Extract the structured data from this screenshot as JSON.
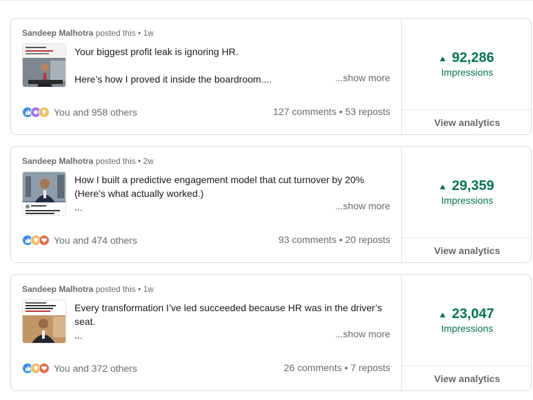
{
  "posts": [
    {
      "author": "Sandeep Malhotra",
      "posted_suffix": " posted this • 1w",
      "lines": [
        "Your biggest profit leak is ignoring HR.",
        "",
        "Here’s how I proved it inside the boardroom...."
      ],
      "show_more": "...show more",
      "reactions": "You and 958 others",
      "stats": "127 comments • 53 reposts",
      "impressions": "92,286",
      "impressions_label": "Impressions",
      "view_analytics": "View analytics"
    },
    {
      "author": "Sandeep Malhotra",
      "posted_suffix": " posted this • 2w",
      "lines": [
        "How I built a predictive engagement model that cut turnover by 20%",
        "(Here’s what actually worked.)",
        "..."
      ],
      "show_more": "...show more",
      "reactions": "You and 474 others",
      "stats": "93 comments • 20 reposts",
      "impressions": "29,359",
      "impressions_label": "Impressions",
      "view_analytics": "View analytics"
    },
    {
      "author": "Sandeep Malhotra",
      "posted_suffix": " posted this • 1w",
      "lines": [
        "Every transformation I’ve led succeeded because HR was in the driver’s",
        "seat.",
        "..."
      ],
      "show_more": "...show more",
      "reactions": "You and 372 others",
      "stats": "26 comments • 7 reposts",
      "impressions": "23,047",
      "impressions_label": "Impressions",
      "view_analytics": "View analytics"
    }
  ],
  "icons": {
    "thumbnail": "post-thumbnail-image",
    "like": "like-reaction-icon",
    "insightful": "insightful-reaction-icon",
    "support": "support-reaction-icon",
    "love": "love-reaction-icon",
    "trend": "up-triangle-icon"
  },
  "colors": {
    "impressions_green": "#01754f",
    "like_blue": "#378fe9",
    "insightful_yellow": "#f5bb5c",
    "love_red": "#df704d",
    "support_purple": "#a872e8"
  }
}
